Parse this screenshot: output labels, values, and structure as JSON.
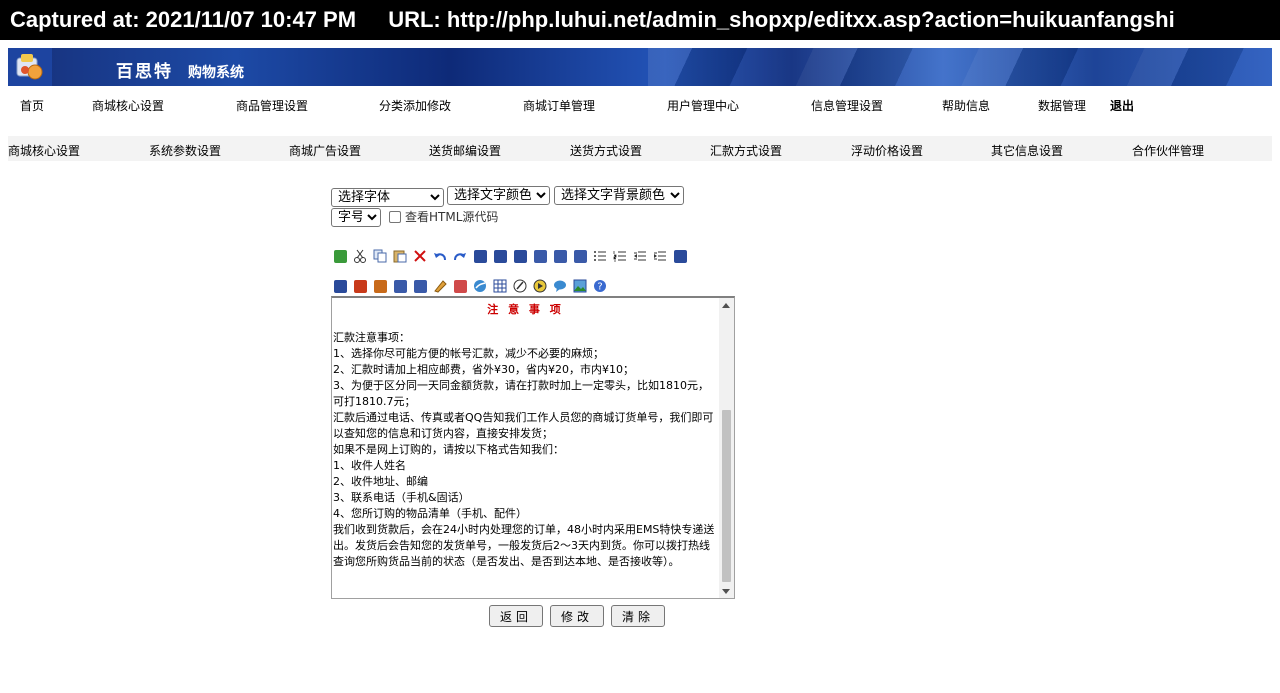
{
  "capture": {
    "timestamp": "Captured at: 2021/11/07 10:47 PM",
    "url": "URL: http://php.luhui.net/admin_shopxp/editxx.asp?action=huikuanfangshi"
  },
  "header": {
    "brand": "百思特",
    "brand_sub": "购物系统"
  },
  "main_nav": [
    {
      "label": "首页"
    },
    {
      "label": "商城核心设置"
    },
    {
      "label": "商品管理设置"
    },
    {
      "label": "分类添加修改"
    },
    {
      "label": "商城订单管理"
    },
    {
      "label": "用户管理中心"
    },
    {
      "label": "信息管理设置"
    },
    {
      "label": "帮助信息"
    },
    {
      "label": "数据管理"
    },
    {
      "label": "退出"
    }
  ],
  "sub_nav": [
    {
      "label": "商城核心设置"
    },
    {
      "label": "系统参数设置"
    },
    {
      "label": "商城广告设置"
    },
    {
      "label": "送货邮编设置"
    },
    {
      "label": "送货方式设置"
    },
    {
      "label": "汇款方式设置"
    },
    {
      "label": "浮动价格设置"
    },
    {
      "label": "其它信息设置"
    },
    {
      "label": "合作伙伴管理"
    }
  ],
  "editor": {
    "font_select": "选择字体",
    "color_select": "选择文字颜色",
    "bg_select": "选择文字背景颜色",
    "size_select": "字号",
    "html_source_label": "查看HTML源代码",
    "content_title": "注 意 事 项",
    "content_lines": [
      "汇款注意事项：",
      "1、选择你尽可能方便的帐号汇款，减少不必要的麻烦；",
      "2、汇款时请加上相应邮费，省外¥30，省内¥20，市内¥10；",
      "3、为便于区分同一天同金额货款，请在打款时加上一定零头，比如1810元，可打1810.7元；",
      "汇款后通过电话、传真或者QQ告知我们工作人员您的商城订货单号，我们即可以查知您的信息和订货内容，直接安排发货；",
      "如果不是网上订购的，请按以下格式告知我们：",
      "1、收件人姓名",
      "2、收件地址、邮编",
      "3、联系电话（手机&固话）",
      "4、您所订购的物品清单（手机、配件）",
      "我们收到货款后，会在24小时内处理您的订单，48小时内采用EMS特快专递送出。发货后会告知您的发货单号，一般发货后2～3天内到货。你可以拨打热线查询您所购货品当前的状态（是否发出、是否到达本地、是否接收等）。"
    ]
  },
  "buttons": {
    "back": "返回",
    "modify": "修改",
    "clear": "清除"
  },
  "toolbar1_icons": [
    "select-all-icon",
    "cut-icon",
    "copy-icon",
    "paste-icon",
    "delete-icon",
    "undo-icon",
    "redo-icon",
    "bold-icon",
    "italic-icon",
    "underline-icon",
    "align-left-icon",
    "align-center-icon",
    "align-right-icon",
    "bulleted-list-icon",
    "numbered-list-icon",
    "outdent-icon",
    "indent-icon",
    "minus-icon"
  ],
  "toolbar2_icons": [
    "minus-icon",
    "special-char-icon",
    "special-char-2-icon",
    "superscript-icon",
    "subscript-icon",
    "eraser-icon",
    "document-icon",
    "link-icon",
    "table-icon",
    "pen-icon",
    "media-icon",
    "speech-icon",
    "image-icon",
    "help-icon"
  ]
}
